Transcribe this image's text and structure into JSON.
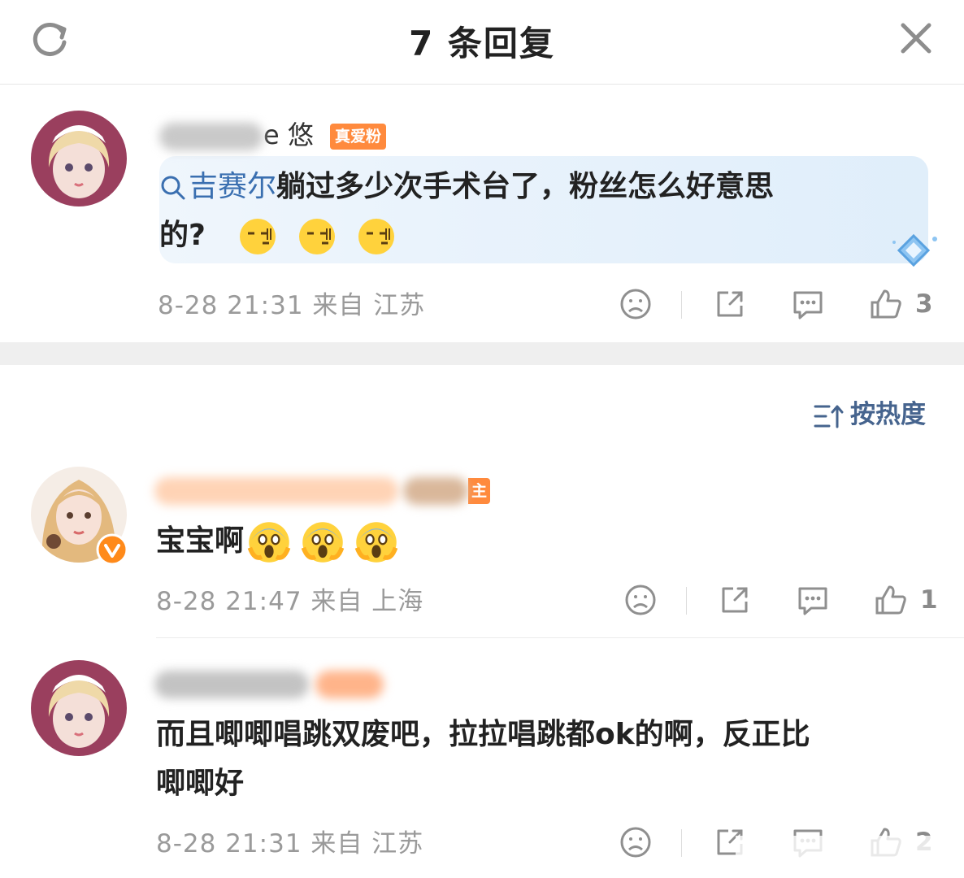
{
  "header": {
    "title": "7 条回复",
    "refresh_icon": "refresh-icon",
    "close_icon": "close-icon"
  },
  "main_comment": {
    "username_visible": "e 悠",
    "badge": "真爱粉",
    "topic": "吉赛尔",
    "text_line1": "躺过多少次手术台了，粉丝怎么好意思",
    "text_line2": "的?",
    "emoji": [
      "smirk-emoji",
      "smirk-emoji",
      "smirk-emoji"
    ],
    "meta": "8-28 21:31 来自 江苏",
    "like_count": "3"
  },
  "sort": {
    "label": "按热度",
    "icon": "sort-icon"
  },
  "replies": [
    {
      "badge_fragment": "主",
      "text": "宝宝啊",
      "emoji": [
        "scream-emoji",
        "scream-emoji",
        "scream-emoji"
      ],
      "meta": "8-28 21:47 来自 上海",
      "like_count": "1"
    },
    {
      "text_line1": "而且唧唧唱跳双废吧，拉拉唱跳都ok的啊，反正比",
      "text_line2": "唧唧好",
      "meta": "8-28 21:31 来自 江苏",
      "like_count": "2"
    }
  ],
  "colors": {
    "topic_blue": "#3a6fb0",
    "badge_orange": "#ff8a3d",
    "meta_gray": "#9a9a9a",
    "sort_blue": "#46648e"
  }
}
